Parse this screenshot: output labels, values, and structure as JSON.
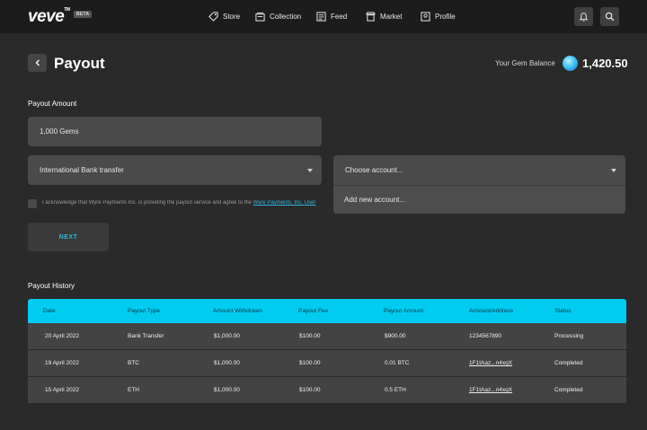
{
  "brand": {
    "logo": "veve",
    "tm": "TM",
    "beta": "BETA"
  },
  "nav": {
    "items": [
      {
        "label": "Store",
        "icon": "tag-icon"
      },
      {
        "label": "Collection",
        "icon": "collection-icon"
      },
      {
        "label": "Feed",
        "icon": "feed-icon"
      },
      {
        "label": "Market",
        "icon": "market-icon"
      },
      {
        "label": "Profile",
        "icon": "profile-icon"
      }
    ],
    "actions": [
      "bell-icon",
      "search-icon"
    ]
  },
  "page": {
    "title": "Payout",
    "balance_label": "Your Gem Balance",
    "balance_value": "1,420.50"
  },
  "form": {
    "amount_label": "Payout Amount",
    "amount_value": "1,000 Gems",
    "method_value": "International Bank transfer",
    "account_placeholder": "Choose account...",
    "account_options": [
      "Add new account..."
    ],
    "ack_text": "I acknowledge that Wyre Payments Inc. is providing the payout service and agree to the ",
    "ack_link": "Wyre Payments, Inc. User",
    "next_label": "NEXT"
  },
  "history": {
    "title": "Payout History",
    "columns": [
      "Date",
      "Payout Type",
      "Amount Withdrawn",
      "Payout Fee",
      "Payout Amount",
      "Account/Address",
      "Status"
    ],
    "rows": [
      [
        "20 April 2022",
        "Bank Transfer",
        "$1,000.00",
        "$100.00",
        "$900.00",
        "1234567890",
        "Processing"
      ],
      [
        "19 April 2022",
        "BTC",
        "$1,000.00",
        "$100.00",
        "0.01 BTC",
        "1F1tAaz...n4xqX",
        "Completed"
      ],
      [
        "15 April 2022",
        "ETH",
        "$1,000.00",
        "$100.00",
        "0.5 ETH",
        "1F1tAaz...n4xqX",
        "Completed"
      ]
    ]
  },
  "colors": {
    "accent": "#00ccf0",
    "link": "#2fb7e0",
    "background": "#2a2a2a",
    "topbar": "#1c1c1c"
  }
}
